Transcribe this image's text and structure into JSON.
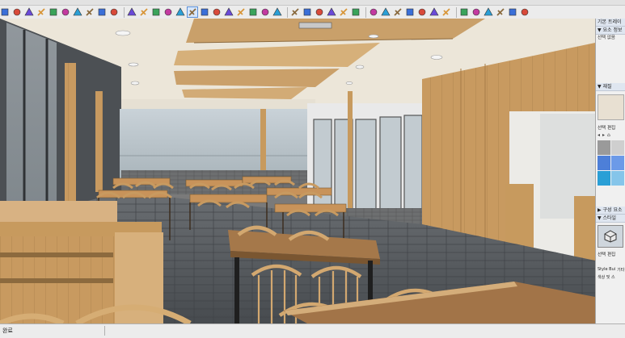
{
  "toolbar": {
    "icons": [
      "select-icon",
      "eraser-icon",
      "line-icon",
      "arc-icon",
      "rectangle-icon",
      "pushpull-icon",
      "move-icon",
      "rotate-icon",
      "scale-icon",
      "offset-icon",
      "tape-icon",
      "text-icon",
      "paint-icon",
      "orbit-icon",
      "pan-icon",
      "zoom-icon",
      "zoom-extents-icon",
      "walk-icon",
      "look-icon",
      "section-icon",
      "component-icon",
      "group-icon",
      "solid-icon",
      "camera-icon",
      "style-xray-icon",
      "style-wire-icon",
      "style-hidden-icon",
      "style-shaded-icon",
      "style-texture-icon",
      "style-mono-icon",
      "view-iso-icon",
      "view-top-icon",
      "view-front-icon",
      "view-right-icon",
      "view-back-icon",
      "view-left-icon",
      "warehouse-icon",
      "extension-icon",
      "layers-icon",
      "scene-icon",
      "shadow-icon",
      "fog-icon"
    ],
    "active_index": 15
  },
  "tray": {
    "header_title": "기본 트레이",
    "entity_info_header": "▼ 요소 정보",
    "entity_info_text": "선택 없음",
    "materials_header": "▼ 재질",
    "material_tabs": [
      "선택",
      "편집"
    ],
    "components_header": "▶ 구성 요소",
    "styles_header": "▼ 스타일",
    "style_tabs": [
      "선택",
      "편집"
    ],
    "style_thumb_labels": [
      "Style Bui",
      "기타"
    ],
    "style_thumb_label2": "색상 및 스",
    "swatch_colors": [
      "#9a9a9a",
      "#cfcfcf",
      "#4d7fd8",
      "#6c9ae8",
      "#2a9fd6",
      "#85c5ea"
    ]
  },
  "status": {
    "text": "완료"
  },
  "viewport": {
    "scene": "restaurant-interior-render",
    "colors": {
      "wood": "#c79a5e",
      "wood_dark": "#8c6a3e",
      "ceiling": "#ece6d9",
      "floor": "#555a5e",
      "window": "#b8c4cb"
    }
  }
}
